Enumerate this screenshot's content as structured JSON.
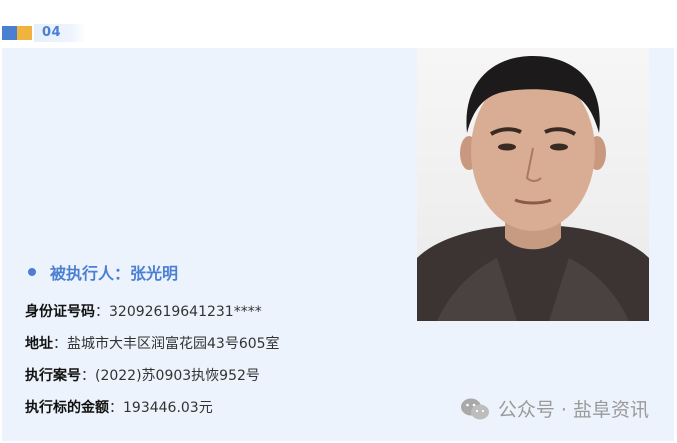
{
  "section": {
    "number": "04"
  },
  "person": {
    "name_label": "被执行人：",
    "name": "张光明",
    "fields": [
      {
        "label": "身份证号码",
        "sep": "：",
        "value": "32092619641231****"
      },
      {
        "label": "地址",
        "sep": "：",
        "value": "盐城市大丰区润富花园43号605室"
      },
      {
        "label": "执行案号",
        "sep": "：",
        "value": "(2022)苏0903执恢952号"
      },
      {
        "label": "执行标的金额",
        "sep": "：",
        "value": "193446.03元"
      }
    ]
  },
  "watermark": {
    "text": "公众号 · 盐阜资讯",
    "icon": "wechat-icon"
  },
  "colors": {
    "accent": "#4a7fd1",
    "card_bg": "#edf3fc",
    "yellow": "#f0b43e"
  }
}
